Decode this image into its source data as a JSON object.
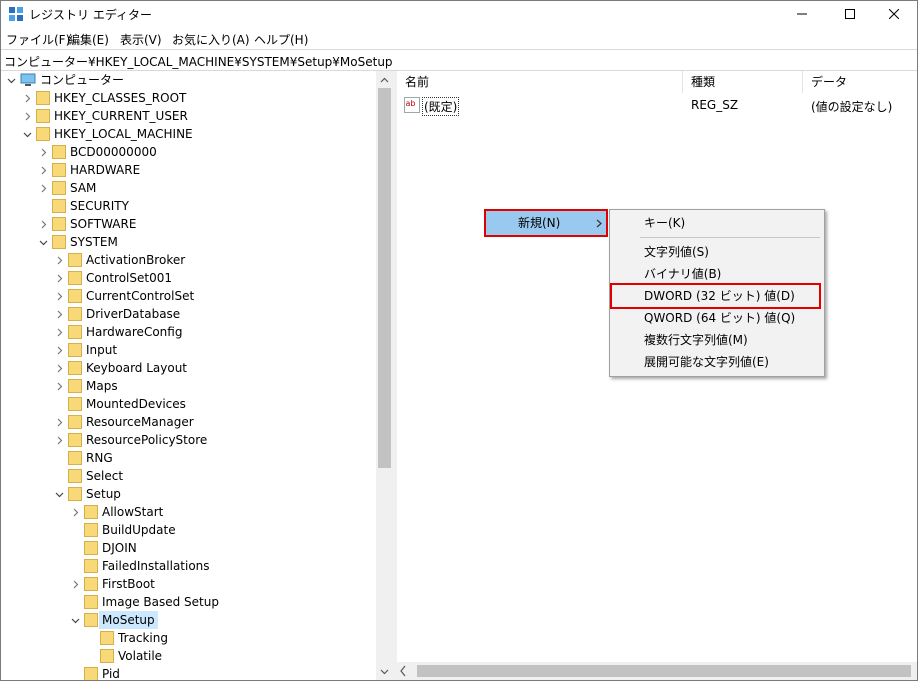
{
  "window": {
    "title": "レジストリ エディター"
  },
  "menu": [
    "ファイル(F)",
    "編集(E)",
    "表示(V)",
    "お気に入り(A)",
    "ヘルプ(H)"
  ],
  "address": "コンピューター¥HKEY_LOCAL_MACHINE¥SYSTEM¥Setup¥MoSetup",
  "tree": {
    "root": "コンピューター",
    "items": [
      {
        "label": "HKEY_CLASSES_ROOT",
        "level": 1,
        "exp": "collapsed"
      },
      {
        "label": "HKEY_CURRENT_USER",
        "level": 1,
        "exp": "collapsed"
      },
      {
        "label": "HKEY_LOCAL_MACHINE",
        "level": 1,
        "exp": "expanded"
      },
      {
        "label": "BCD00000000",
        "level": 2,
        "exp": "collapsed"
      },
      {
        "label": "HARDWARE",
        "level": 2,
        "exp": "collapsed"
      },
      {
        "label": "SAM",
        "level": 2,
        "exp": "collapsed"
      },
      {
        "label": "SECURITY",
        "level": 2,
        "exp": "none"
      },
      {
        "label": "SOFTWARE",
        "level": 2,
        "exp": "collapsed"
      },
      {
        "label": "SYSTEM",
        "level": 2,
        "exp": "expanded"
      },
      {
        "label": "ActivationBroker",
        "level": 3,
        "exp": "collapsed"
      },
      {
        "label": "ControlSet001",
        "level": 3,
        "exp": "collapsed"
      },
      {
        "label": "CurrentControlSet",
        "level": 3,
        "exp": "collapsed"
      },
      {
        "label": "DriverDatabase",
        "level": 3,
        "exp": "collapsed"
      },
      {
        "label": "HardwareConfig",
        "level": 3,
        "exp": "collapsed"
      },
      {
        "label": "Input",
        "level": 3,
        "exp": "collapsed"
      },
      {
        "label": "Keyboard Layout",
        "level": 3,
        "exp": "collapsed"
      },
      {
        "label": "Maps",
        "level": 3,
        "exp": "collapsed"
      },
      {
        "label": "MountedDevices",
        "level": 3,
        "exp": "none"
      },
      {
        "label": "ResourceManager",
        "level": 3,
        "exp": "collapsed"
      },
      {
        "label": "ResourcePolicyStore",
        "level": 3,
        "exp": "collapsed"
      },
      {
        "label": "RNG",
        "level": 3,
        "exp": "none"
      },
      {
        "label": "Select",
        "level": 3,
        "exp": "none"
      },
      {
        "label": "Setup",
        "level": 3,
        "exp": "expanded"
      },
      {
        "label": "AllowStart",
        "level": 4,
        "exp": "collapsed"
      },
      {
        "label": "BuildUpdate",
        "level": 4,
        "exp": "none"
      },
      {
        "label": "DJOIN",
        "level": 4,
        "exp": "none"
      },
      {
        "label": "FailedInstallations",
        "level": 4,
        "exp": "none"
      },
      {
        "label": "FirstBoot",
        "level": 4,
        "exp": "collapsed"
      },
      {
        "label": "Image Based Setup",
        "level": 4,
        "exp": "none"
      },
      {
        "label": "MoSetup",
        "level": 4,
        "exp": "expanded",
        "selected": true
      },
      {
        "label": "Tracking",
        "level": 5,
        "exp": "none"
      },
      {
        "label": "Volatile",
        "level": 5,
        "exp": "none"
      },
      {
        "label": "Pid",
        "level": 4,
        "exp": "none"
      }
    ]
  },
  "list": {
    "headers": [
      "名前",
      "種類",
      "データ"
    ],
    "rows": [
      {
        "name": "(既定)",
        "type": "REG_SZ",
        "data": "(値の設定なし)"
      }
    ]
  },
  "context_menu": {
    "new_label": "新規(N)"
  },
  "submenu": {
    "key": "キー(K)",
    "items": [
      "文字列値(S)",
      "バイナリ値(B)",
      "DWORD (32 ビット) 値(D)",
      "QWORD (64 ビット) 値(Q)",
      "複数行文字列値(M)",
      "展開可能な文字列値(E)"
    ]
  },
  "colors": {
    "selection_blue": "#99c9ef",
    "highlight_red": "#e00000",
    "selected_tree": "#cce8ff"
  }
}
